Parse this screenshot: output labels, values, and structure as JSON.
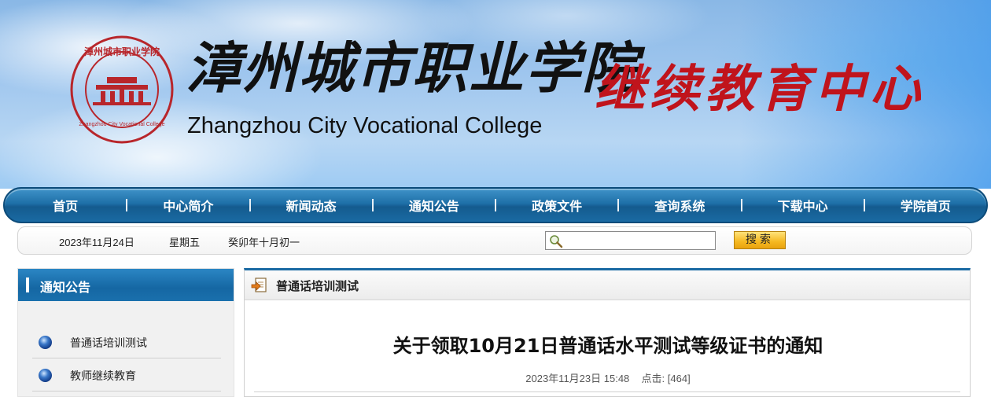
{
  "banner": {
    "seal_text": "漳州城市职业学院",
    "seal_text_en": "Zhangzhou City Vocational College",
    "title_cn": "漳州城市职业学院",
    "title_en": "Zhangzhou City Vocational College",
    "subtitle_red": "继续教育中心",
    "colors": {
      "sky": "#9fc6ee",
      "red": "#c0141c"
    }
  },
  "nav": {
    "items": [
      {
        "label": "首页"
      },
      {
        "label": "中心简介"
      },
      {
        "label": "新闻动态"
      },
      {
        "label": "通知公告"
      },
      {
        "label": "政策文件"
      },
      {
        "label": "查询系统"
      },
      {
        "label": "下载中心"
      },
      {
        "label": "学院首页"
      }
    ],
    "color": "#1a6aa3"
  },
  "infobar": {
    "date": "2023年11月24日",
    "weekday": "星期五",
    "lunar": "癸卯年十月初一",
    "search": {
      "placeholder": "",
      "value": "",
      "button_label": "搜索"
    }
  },
  "sidebar": {
    "title": "通知公告",
    "items": [
      {
        "label": "普通话培训测试"
      },
      {
        "label": "教师继续教育"
      }
    ]
  },
  "main": {
    "section_title": "普通话培训测试",
    "article": {
      "title": "关于领取10月21日普通话水平测试等级证书的通知",
      "datetime": "2023年11月23日 15:48",
      "clicks_label": "点击:",
      "clicks_value": "[464]"
    }
  }
}
